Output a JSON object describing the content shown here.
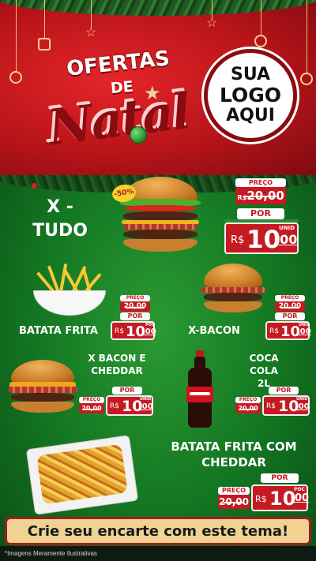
{
  "header": {
    "title_line1": "OFERTAS",
    "title_line2": "DE",
    "title_line3": "Natal",
    "logo_line1": "SUA",
    "logo_line2": "LOGO",
    "logo_line3": "AQUI"
  },
  "products": {
    "xtudo": {
      "name_line1": "X -",
      "name_line2": "TUDO",
      "discount": "-50%",
      "old_label": "PREÇO",
      "old_price": "20,00",
      "new_label": "POR",
      "currency": "R$",
      "price_int": "10",
      "price_cents": ",00",
      "unit": "UNID"
    },
    "batata": {
      "name": "BATATA FRITA",
      "old_label": "PREÇO",
      "old_price": "20,00",
      "new_label": "POR",
      "currency": "R$",
      "price_int": "10",
      "price_cents": ",00",
      "unit": "POC"
    },
    "xbacon": {
      "name": "X-BACON",
      "old_label": "PREÇO",
      "old_price": "20,00",
      "new_label": "POR",
      "currency": "R$",
      "price_int": "10",
      "price_cents": ",00",
      "unit": "UNID"
    },
    "xbacon_cheddar": {
      "name_line1": "X BACON E",
      "name_line2": "CHEDDAR",
      "old_label": "PREÇO",
      "old_price": "20,00",
      "new_label": "POR",
      "currency": "R$",
      "price_int": "10",
      "price_cents": ",00",
      "unit": "UNID"
    },
    "coca": {
      "name_line1": "COCA COLA",
      "name_line2": "2L",
      "old_label": "PREÇO",
      "old_price": "20,00",
      "new_label": "POR",
      "currency": "R$",
      "price_int": "10",
      "price_cents": ",00",
      "unit": "UNID"
    },
    "batata_cheddar": {
      "name_line1": "BATATA FRITA COM",
      "name_line2": "CHEDDAR",
      "old_label": "PREÇO",
      "old_price": "20,00",
      "new_label": "POR",
      "currency": "R$",
      "price_int": "10",
      "price_cents": ",00",
      "unit": "POC"
    }
  },
  "cta": "Crie seu encarte com este tema!",
  "footer": "*Imagens Meramente Ilustrativas",
  "colors": {
    "header_red": "#c51a22",
    "main_green": "#137622",
    "cta_bg": "#f0d392",
    "cta_border": "#9c1f1f"
  },
  "icons": [
    "christmas-garland",
    "ornament-ball-icon",
    "star-ornament-icon",
    "gift-ornament-icon"
  ]
}
